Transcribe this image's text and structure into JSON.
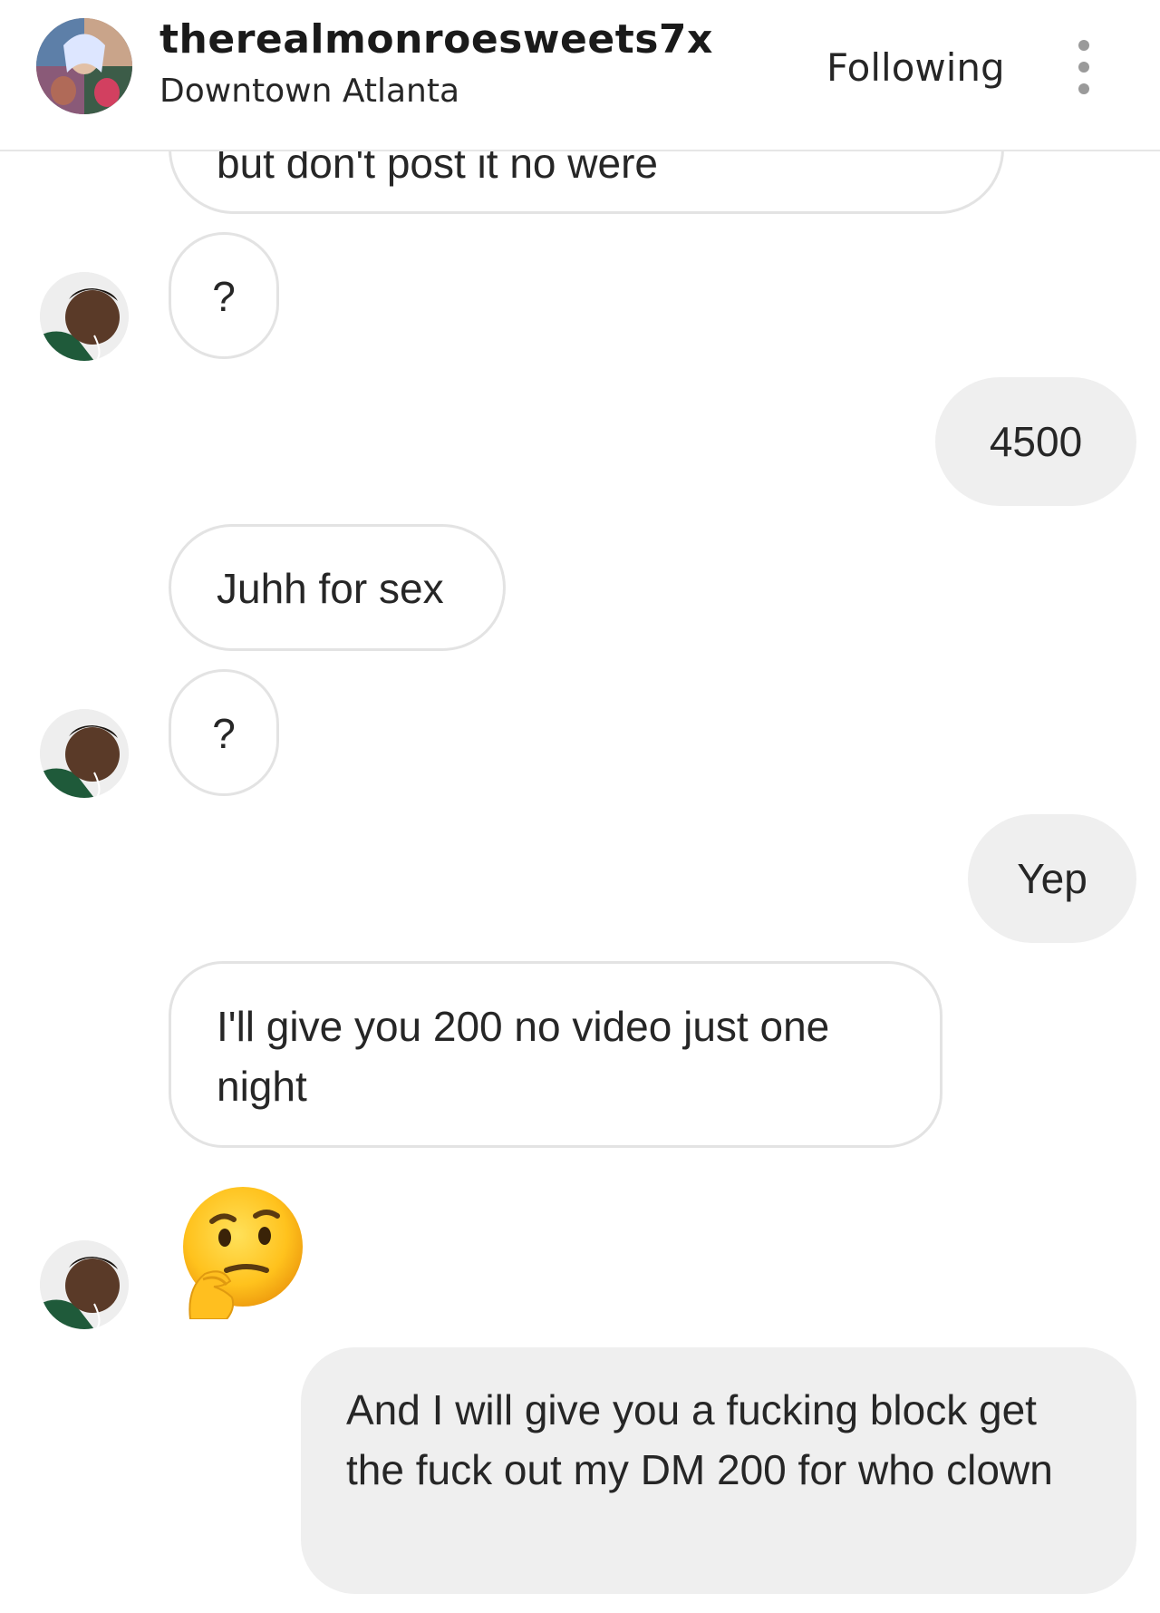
{
  "header": {
    "username": "therealmonroesweets7x",
    "location": "Downtown Atlanta",
    "follow_label": "Following",
    "more_icon": "more-vertical-icon"
  },
  "messages": [
    {
      "sender": "other",
      "text": "but don't post it no were"
    },
    {
      "sender": "them",
      "text": "?"
    },
    {
      "sender": "me",
      "text": "4500"
    },
    {
      "sender": "other",
      "text": "Juhh for sex"
    },
    {
      "sender": "them",
      "text": "?"
    },
    {
      "sender": "me",
      "text": "Yep"
    },
    {
      "sender": "other",
      "text": "I'll give you 200 no video just one night"
    },
    {
      "sender": "them",
      "emoji": "thinking-face-emoji"
    },
    {
      "sender": "me",
      "text": "And I will give you a fucking block get the fuck out my DM 200 for who clown"
    }
  ]
}
